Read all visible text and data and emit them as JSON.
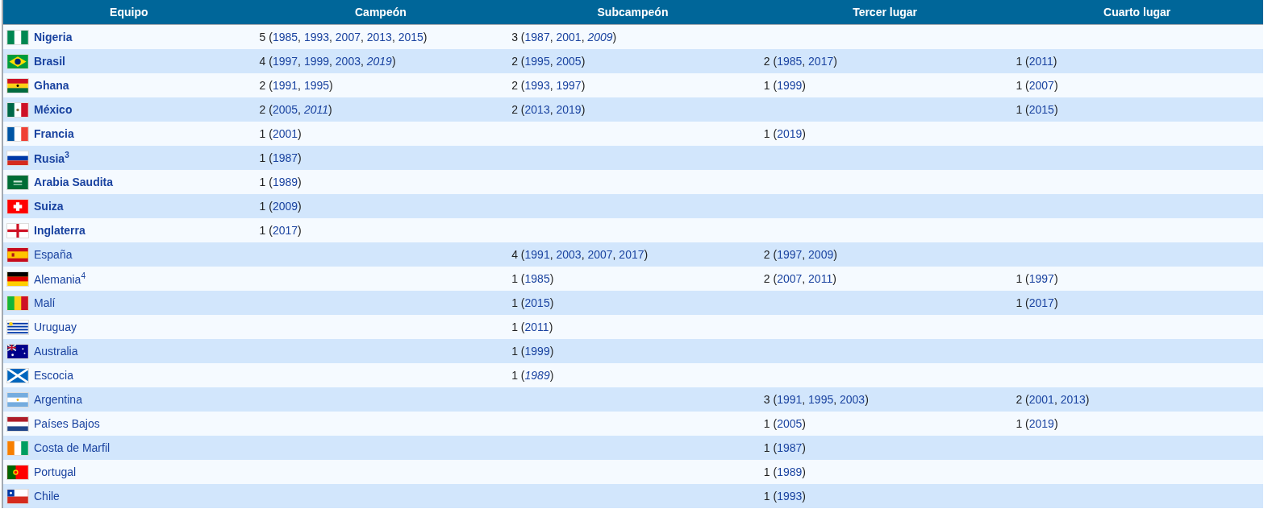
{
  "table": {
    "columns": [
      "Equipo",
      "Campeón",
      "Subcampeón",
      "Tercer lugar",
      "Cuarto lugar"
    ],
    "rows": [
      {
        "team": "Nigeria",
        "kind": "nigeria",
        "bold": true,
        "champion": "5 (1985, 1993, 2007, 2013, 2015)",
        "runner_up": "3 (1987, 2001, *2009*)"
      },
      {
        "team": "Brasil",
        "kind": "brazil",
        "bold": true,
        "champion": "4 (1997, 1999, 2003, *2019*)",
        "runner_up": "2 (1995, 2005)",
        "third": "2 (1985, 2017)",
        "fourth": "1 (2011)"
      },
      {
        "team": "Ghana",
        "kind": "ghana",
        "bold": true,
        "champion": "2 (1991, 1995)",
        "runner_up": "2 (1993, 1997)",
        "third": "1 (1999)",
        "fourth": "1 (2007)"
      },
      {
        "team": "México",
        "kind": "mexico",
        "bold": true,
        "champion": "2 (2005, *2011*)",
        "runner_up": "2 (2013, 2019)",
        "fourth": "1 (2015)"
      },
      {
        "team": "Francia",
        "kind": "france",
        "bold": true,
        "champion": "1 (2001)",
        "third": "1 (2019)"
      },
      {
        "team": "Rusia$^{3}$",
        "kind": "russia",
        "bold": true,
        "champion": "1 (1987)"
      },
      {
        "team": "Arabia Saudita",
        "kind": "saudi",
        "bold": true,
        "champion": "1 (1989)"
      },
      {
        "team": "Suiza",
        "kind": "swiss",
        "bold": true,
        "champion": "1 (2009)"
      },
      {
        "team": "Inglaterra",
        "kind": "england",
        "bold": true,
        "champion": "1 (2017)"
      },
      {
        "team": "España",
        "kind": "spain",
        "bold": false,
        "runner_up": "4 (1991, 2003, 2007, 2017)",
        "third": "2 (1997, 2009)"
      },
      {
        "team": "Alemania$^{4}$",
        "kind": "germany",
        "bold": false,
        "runner_up": "1 (1985)",
        "third": "2 (2007, 2011)",
        "fourth": "1 (1997)"
      },
      {
        "team": "Malí",
        "kind": "mali",
        "bold": false,
        "runner_up": "1 (2015)",
        "fourth": "1 (2017)"
      },
      {
        "team": "Uruguay",
        "kind": "uruguay",
        "bold": false,
        "runner_up": "1 (2011)"
      },
      {
        "team": "Australia",
        "kind": "australia",
        "bold": false,
        "runner_up": "1 (1999)"
      },
      {
        "team": "Escocia",
        "kind": "scotland",
        "bold": false,
        "runner_up": "1 (*1989*)"
      },
      {
        "team": "Argentina",
        "kind": "argentina",
        "bold": false,
        "third": "3 (1991, 1995, 2003)",
        "fourth": "2 (2001, 2013)"
      },
      {
        "team": "Países Bajos",
        "kind": "netherlands",
        "bold": false,
        "third": "1 (2005)",
        "fourth": "1 (2019)"
      },
      {
        "team": "Costa de Marfil",
        "kind": "ivory",
        "bold": false,
        "third": "1 (1987)"
      },
      {
        "team": "Portugal",
        "kind": "portugal",
        "bold": false,
        "third": "1 (1989)"
      },
      {
        "team": "Chile",
        "kind": "chile",
        "bold": false,
        "third": "1 (1993)"
      }
    ]
  }
}
